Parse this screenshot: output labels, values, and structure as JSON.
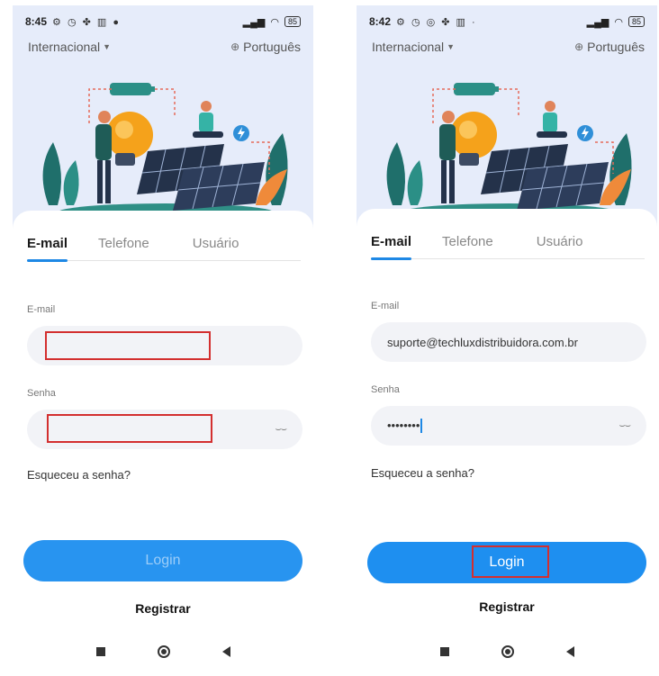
{
  "screens": [
    {
      "status": {
        "time": "8:45",
        "icons": "⚙ ◷ ✤ ▥ ●",
        "battery": "85"
      },
      "region": "Internacional",
      "language": "Português",
      "tabs": [
        "E-mail",
        "Telefone",
        "Usuário"
      ],
      "active_tab": "E-mail",
      "email_label": "E-mail",
      "email_value": "",
      "password_label": "Senha",
      "password_value": "",
      "forgot": "Esqueceu a senha?",
      "login": "Login",
      "register": "Registrar"
    },
    {
      "status": {
        "time": "8:42",
        "icons": "⚙ ◷ ◎ ✤ ▥ ·",
        "battery": "85"
      },
      "region": "Internacional",
      "language": "Português",
      "tabs": [
        "E-mail",
        "Telefone",
        "Usuário"
      ],
      "active_tab": "E-mail",
      "email_label": "E-mail",
      "email_value": "suporte@techluxdistribuidora.com.br",
      "password_label": "Senha",
      "password_value": "••••••••",
      "forgot": "Esqueceu a senha?",
      "login": "Login",
      "register": "Registrar"
    }
  ],
  "colors": {
    "accent": "#1e88e5",
    "button": "#1e8ff0",
    "hero_bg": "#e6ecfa",
    "field_bg": "#f2f3f7",
    "annotation": "#d32f2f"
  },
  "icons": [
    "eye-closed-icon",
    "globe-icon",
    "caret-down-icon",
    "wifi-icon",
    "signal-icon",
    "battery-icon"
  ]
}
